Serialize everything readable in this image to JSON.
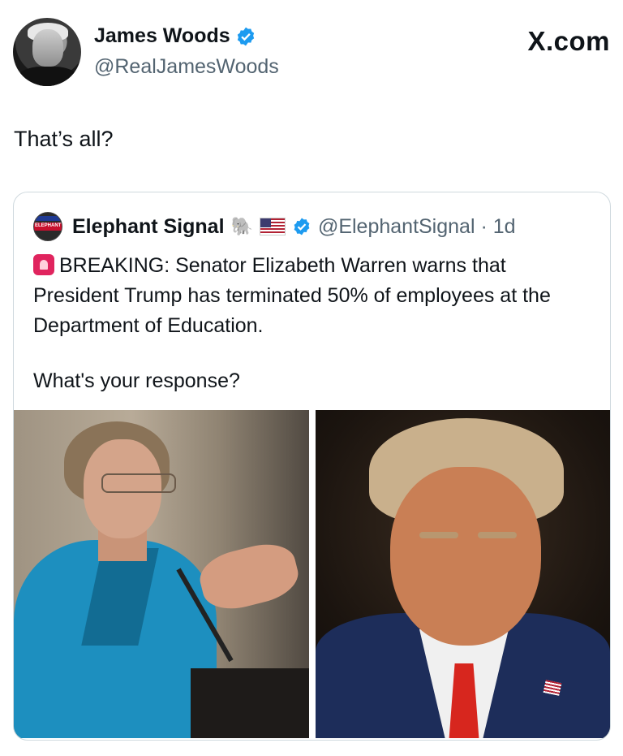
{
  "author": {
    "name": "James Woods",
    "handle": "@RealJamesWoods"
  },
  "brand": "X.com",
  "post": {
    "text": "That’s all?"
  },
  "quoted_post": {
    "author_name": "Elephant Signal",
    "avatar_text": "ELEPHANT",
    "emojis": [
      "🐘",
      "🇺🇸"
    ],
    "handle_time": "@ElephantSignal · 1d",
    "body": "BREAKING: Senator Elizabeth Warren warns that President Trump has terminated 50% of employees at the Department of Education.",
    "question": "What's your response?",
    "images": [
      "elizabeth-warren-photo",
      "donald-trump-photo"
    ]
  },
  "colors": {
    "verified": "#1d9bf0",
    "secondary_text": "#536471",
    "border": "#cfd9de"
  }
}
